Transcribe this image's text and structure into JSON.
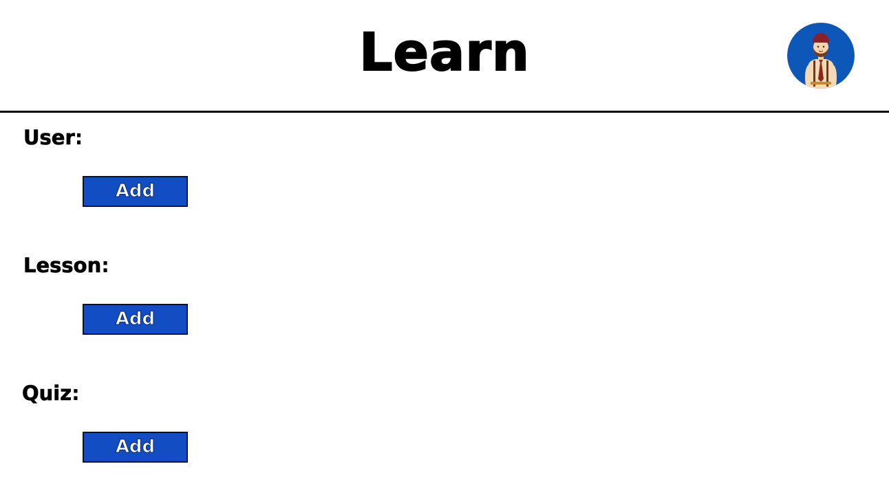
{
  "header": {
    "title": "Learn",
    "avatar_icon": "user-avatar-icon"
  },
  "sections": [
    {
      "label": "User",
      "colon": ":",
      "button_label": "Add"
    },
    {
      "label": "Lesson",
      "colon": ":",
      "button_label": "Add"
    },
    {
      "label": "Quiz",
      "colon": ":",
      "button_label": "Add"
    }
  ],
  "colors": {
    "accent": "#134dc4",
    "avatar_bg": "#0d57b8",
    "text": "#000000",
    "background": "#ffffff"
  }
}
